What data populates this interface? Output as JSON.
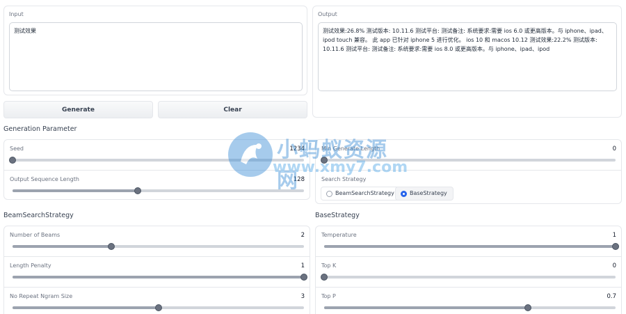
{
  "input": {
    "label": "Input",
    "value": "测试效果"
  },
  "output": {
    "label": "Output",
    "value": "测试效果:26.8% 测试版本: 10.11.6 测试平台: 测试备注: 系统要求:需要 ios 6.0 或更高版本。与 iphone、ipad、ipod touch 兼容。 此 app 已针对 iphone 5 进行优化。 ios 10 和 macos 10.12 测试效果:22.2% 测试版本: 10.11.6 测试平台: 测试备注: 系统要求:需要 ios 8.0 或更高版本。与 iphone、ipad、ipod"
  },
  "buttons": {
    "generate": "Generate",
    "clear": "Clear"
  },
  "generation": {
    "title": "Generation Parameter",
    "seed": {
      "label": "Seed",
      "value": "1234",
      "fraction": 0.0
    },
    "output_len": {
      "label": "Output Sequence Length",
      "value": "128",
      "fraction": 0.43
    },
    "min_len": {
      "label": "Min Generate Length",
      "value": "0",
      "fraction": 0.0
    },
    "strategy": {
      "label": "Search Strategy",
      "options": [
        "BeamSearchStrategy",
        "BaseStrategy"
      ],
      "selected": "BaseStrategy"
    }
  },
  "beam": {
    "title": "BeamSearchStrategy",
    "num_beams": {
      "label": "Number of Beams",
      "value": "2",
      "fraction": 0.34
    },
    "length_penalty": {
      "label": "Length Penalty",
      "value": "1",
      "fraction": 1.0
    },
    "no_repeat": {
      "label": "No Repeat Ngram Size",
      "value": "3",
      "fraction": 0.5
    }
  },
  "base": {
    "title": "BaseStrategy",
    "temperature": {
      "label": "Temperature",
      "value": "1",
      "fraction": 1.0
    },
    "top_k": {
      "label": "Top K",
      "value": "0",
      "fraction": 0.0
    },
    "top_p": {
      "label": "Top P",
      "value": "0.7",
      "fraction": 0.7
    }
  },
  "watermark": {
    "cn": "小蚂蚁资源网",
    "url": "www.xmy7.com"
  }
}
